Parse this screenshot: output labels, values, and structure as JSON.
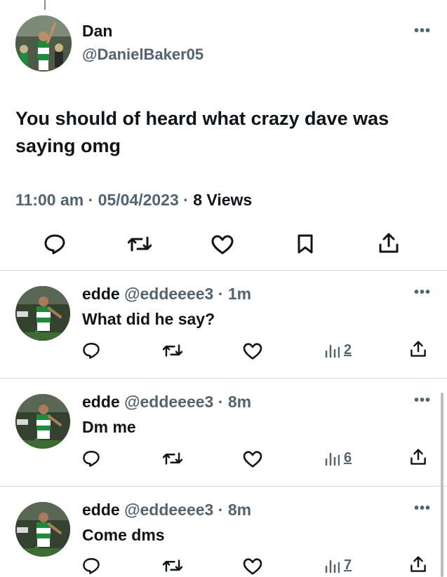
{
  "main_tweet": {
    "author_name": "Dan",
    "author_handle": "@DanielBaker05",
    "text": "You should of heard what crazy dave was saying omg",
    "time": "11:00 am",
    "date": "05/04/2023",
    "views_count": "8",
    "views_label": "Views",
    "separator": "·"
  },
  "replies": [
    {
      "author_name": "edde",
      "author_handle": "@eddeeee3",
      "age": "1m",
      "text": "What did he say?",
      "views": "2"
    },
    {
      "author_name": "edde",
      "author_handle": "@eddeeee3",
      "age": "8m",
      "text": "Dm me",
      "views": "6"
    },
    {
      "author_name": "edde",
      "author_handle": "@eddeeee3",
      "age": "8m",
      "text": "Come dms",
      "views": "7"
    }
  ],
  "icons": {
    "more": "more-icon",
    "reply": "reply-icon",
    "retweet": "retweet-icon",
    "like": "heart-icon",
    "bookmark": "bookmark-icon",
    "share": "share-icon",
    "views": "views-icon"
  },
  "colors": {
    "text": "#0f1419",
    "secondary": "#536471",
    "divider": "#cfd9de",
    "jersey_green": "#1f8a3c"
  }
}
